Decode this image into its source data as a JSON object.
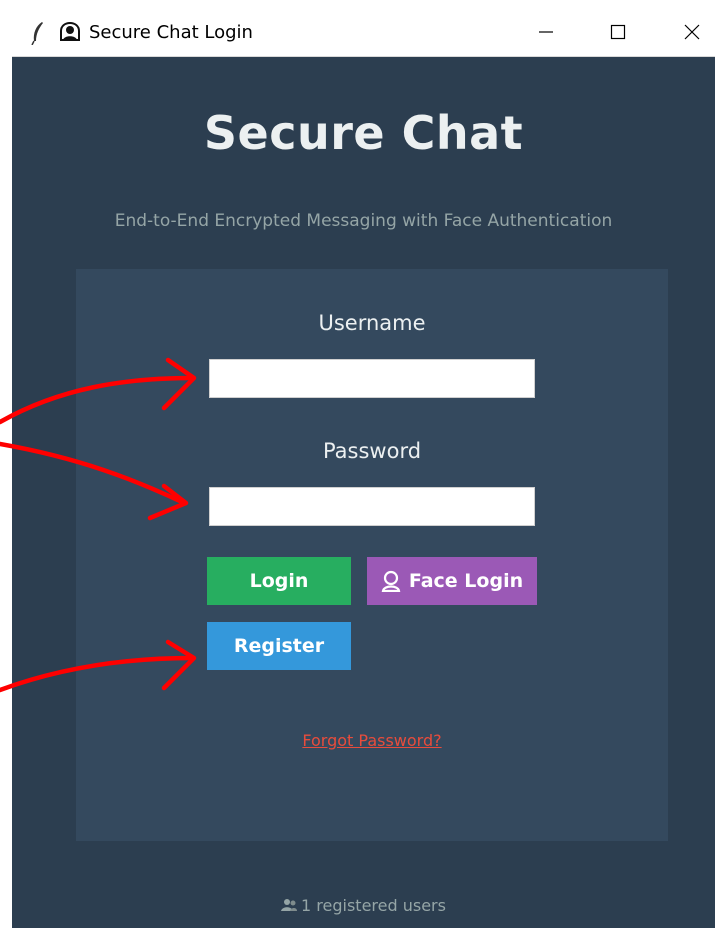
{
  "window": {
    "title": "Secure Chat Login",
    "controls": [
      "minimize",
      "maximize",
      "close"
    ]
  },
  "app": {
    "title": "Secure Chat",
    "subtitle": "End-to-End Encrypted Messaging with Face Authentication"
  },
  "form": {
    "username_label": "Username",
    "username_value": "",
    "password_label": "Password",
    "password_value": ""
  },
  "buttons": {
    "login": "Login",
    "face_login": "Face Login",
    "register": "Register"
  },
  "links": {
    "forgot_password": "Forgot Password?"
  },
  "footer": {
    "registered_users": "1 registered users"
  },
  "colors": {
    "background": "#2c3e50",
    "panel": "#34495e",
    "login_button": "#27ae60",
    "face_login_button": "#9b59b6",
    "register_button": "#3498db",
    "forgot_link": "#e74c3c",
    "annotation_arrow": "#ff0000"
  },
  "icons": {
    "title_bar": [
      "feather-icon",
      "app-icon"
    ],
    "face_login": "face-icon",
    "footer": "users-icon"
  }
}
